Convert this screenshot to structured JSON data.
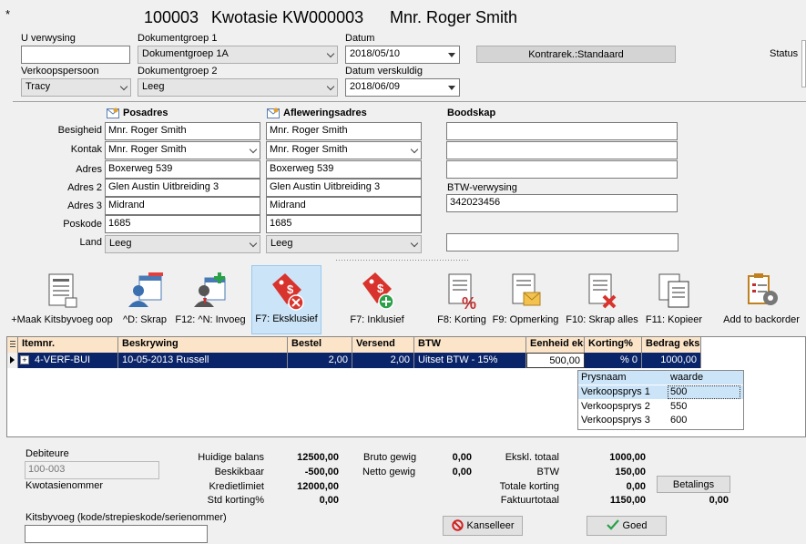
{
  "header": {
    "marker": "*",
    "number": "100003",
    "title": "Kwotasie KW000003",
    "customer": "Mnr. Roger Smith"
  },
  "top": {
    "u_verwysing_label": "U verwysing",
    "u_verwysing_value": "",
    "dokgroep1_label": "Dokumentgroep 1",
    "dokgroep1_value": "Dokumentgroep 1A",
    "datum_label": "Datum",
    "datum_value": "2018/05/10",
    "kontrarek_label": "Kontrarek.:Standaard",
    "status_label": "Status",
    "verkoopspersoon_label": "Verkoopspersoon",
    "verkoopspersoon_value": "Tracy",
    "dokgroep2_label": "Dokumentgroep 2",
    "dokgroep2_value": "Leeg",
    "datum_verskuldig_label": "Datum verskuldig",
    "datum_verskuldig_value": "2018/06/09"
  },
  "address": {
    "posadres_title": "Posadres",
    "aflewering_title": "Afleweringsadres",
    "boodskap_title": "Boodskap",
    "labels": {
      "besigheid": "Besigheid",
      "kontak": "Kontak",
      "adres": "Adres",
      "adres2": "Adres 2",
      "adres3": "Adres 3",
      "poskode": "Poskode",
      "land": "Land"
    },
    "pos": {
      "besigheid": "Mnr. Roger Smith",
      "kontak": "Mnr. Roger Smith",
      "adres": "Boxerweg 539",
      "adres2": "Glen Austin Uitbreiding 3",
      "adres3": "Midrand",
      "poskode": "1685",
      "land": "Leeg"
    },
    "afl": {
      "besigheid": "Mnr. Roger Smith",
      "kontak": "Mnr. Roger Smith",
      "adres": "Boxerweg 539",
      "adres2": "Glen Austin Uitbreiding 3",
      "adres3": "Midrand",
      "poskode": "1685",
      "land": "Leeg"
    },
    "btw_label": "BTW-verwysing",
    "btw_value": "342023456"
  },
  "toolbar": {
    "kitsbyvoeg": "+Maak Kitsbyvoeg oop",
    "skrap": "^D: Skrap",
    "invoeg": "F12: ^N: Invoeg",
    "eksklusief": "F7: Eksklusief",
    "inklusief": "F7: Inklusief",
    "korting": "F8: Korting",
    "opmerking": "F9: Opmerking",
    "skrap_alles": "F10: Skrap alles",
    "kopieer": "F11: Kopieer",
    "backorder": "Add to backorder"
  },
  "grid": {
    "headers": [
      "Itemnr.",
      "Beskrywing",
      "Bestel",
      "Versend",
      "BTW",
      "Eenheid eks",
      "Korting%",
      "Bedrag eks"
    ],
    "rows": [
      {
        "item": "4-VERF-BUI",
        "besk": "10-05-2013 Russell",
        "bestel": "2,00",
        "versend": "2,00",
        "btw": "Uitset BTW - 15%",
        "eenheid": "500,00",
        "korting": "% 0",
        "bedrag": "1000,00"
      }
    ]
  },
  "popup": {
    "headers": [
      "Prysnaam",
      "waarde"
    ],
    "rows": [
      [
        "Verkoopsprys 1",
        "500"
      ],
      [
        "Verkoopsprys 2",
        "550"
      ],
      [
        "Verkoopsprys 3",
        "600"
      ]
    ]
  },
  "footer": {
    "debiteure_label": "Debiteure",
    "debiteure_value": "100-003",
    "kwotasie_label": "Kwotasienommer",
    "kits_label": "Kitsbyvoeg (kode/strepieskode/serienommer)",
    "huidige_label": "Huidige balans",
    "huidige_value": "12500,00",
    "beskikbaar_label": "Beskikbaar",
    "beskikbaar_value": "-500,00",
    "kredietlimiet_label": "Kredietlimiet",
    "kredietlimiet_value": "12000,00",
    "std_label": "Std korting%",
    "std_value": "0,00",
    "bruto_label": "Bruto gewig",
    "bruto_value": "0,00",
    "netto_label": "Netto gewig",
    "netto_value": "0,00",
    "eksk_label": "Ekskl. totaal",
    "eksk_value": "1000,00",
    "btw_label": "BTW",
    "btw_value": "150,00",
    "totale_label": "Totale korting",
    "totale_value": "0,00",
    "faktuur_label": "Faktuurtotaal",
    "faktuur_value": "1150,00",
    "betalings_label": "Betalings",
    "betalings_value": "0,00",
    "kanselleer_label": "Kanselleer",
    "goed_label": "Goed"
  }
}
